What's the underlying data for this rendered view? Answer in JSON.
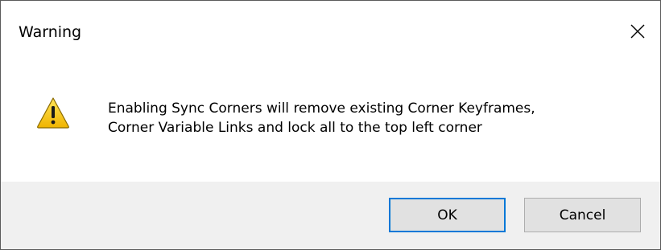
{
  "window": {
    "title": "Warning",
    "close_icon": "close-icon"
  },
  "message": {
    "icon": "warning-icon",
    "line1": "Enabling Sync Corners will remove existing Corner Keyframes,",
    "line2": "Corner Variable Links and lock all to the top left corner"
  },
  "buttons": {
    "ok_label": "OK",
    "cancel_label": "Cancel"
  },
  "colors": {
    "accent": "#0078d7",
    "footer_bg": "#f0f0f0",
    "button_bg": "#e1e1e1",
    "warning_yellow": "#f5c400"
  }
}
